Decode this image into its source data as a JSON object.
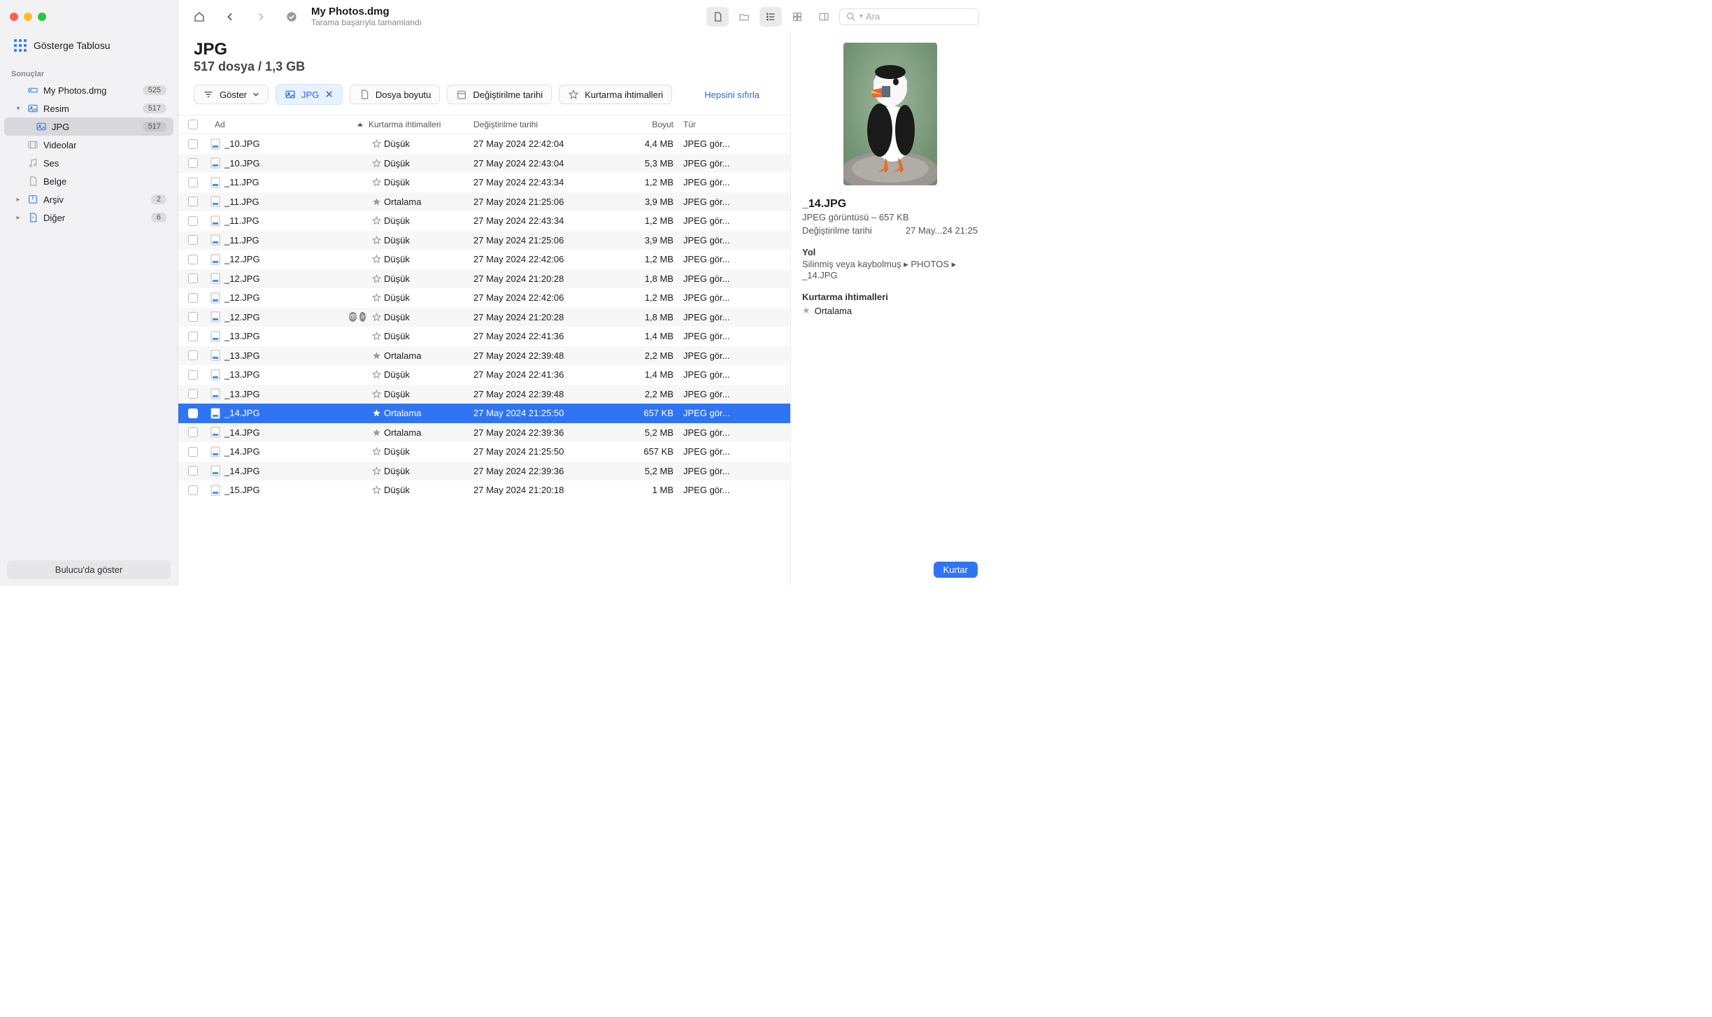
{
  "sidebar": {
    "dashboard": "Gösterge Tablosu",
    "sectionTitle": "Sonuçlar",
    "items": [
      {
        "label": "My Photos.dmg",
        "badge": "525",
        "icon": "drive",
        "chev": ""
      },
      {
        "label": "Resim",
        "badge": "517",
        "icon": "image",
        "chev": "▾"
      },
      {
        "label": "JPG",
        "badge": "517",
        "icon": "image",
        "sub": true,
        "active": true
      },
      {
        "label": "Videolar",
        "icon": "video"
      },
      {
        "label": "Ses",
        "icon": "audio"
      },
      {
        "label": "Belge",
        "icon": "doc"
      },
      {
        "label": "Arşiv",
        "badge": "2",
        "icon": "archive",
        "chev": "▸"
      },
      {
        "label": "Diğer",
        "badge": "6",
        "icon": "other",
        "chev": "▸"
      }
    ],
    "footerBtn": "Bulucu'da göster"
  },
  "toolbar": {
    "title": "My Photos.dmg",
    "subtitle": "Tarama başarıyla tamamlandı",
    "searchPlaceholder": "Ara"
  },
  "header": {
    "title": "JPG",
    "subtitle": "517 dosya / 1,3 GB"
  },
  "filters": {
    "show": "Göster",
    "active": "JPG",
    "size": "Dosya boyutu",
    "date": "Değiştirilme tarihi",
    "prob": "Kurtarma ihtimalleri",
    "reset": "Hepsini sıfırla"
  },
  "columns": {
    "name": "Ad",
    "prob": "Kurtarma ihtimalleri",
    "date": "Değiştirilme tarihi",
    "size": "Boyut",
    "type": "Tür"
  },
  "rows": [
    {
      "name": "_10.JPG",
      "prob": "Düşük",
      "star": false,
      "date": "27 May 2024 22:42:04",
      "size": "4,4 MB",
      "type": "JPEG gör..."
    },
    {
      "name": "_10.JPG",
      "prob": "Düşük",
      "star": false,
      "date": "27 May 2024 22:43:04",
      "size": "5,3 MB",
      "type": "JPEG gör..."
    },
    {
      "name": "_11.JPG",
      "prob": "Düşük",
      "star": false,
      "date": "27 May 2024 22:43:34",
      "size": "1,2 MB",
      "type": "JPEG gör..."
    },
    {
      "name": "_11.JPG",
      "prob": "Ortalama",
      "star": true,
      "date": "27 May 2024 21:25:06",
      "size": "3,9 MB",
      "type": "JPEG gör..."
    },
    {
      "name": "_11.JPG",
      "prob": "Düşük",
      "star": false,
      "date": "27 May 2024 22:43:34",
      "size": "1,2 MB",
      "type": "JPEG gör..."
    },
    {
      "name": "_11.JPG",
      "prob": "Düşük",
      "star": false,
      "date": "27 May 2024 21:25:06",
      "size": "3,9 MB",
      "type": "JPEG gör..."
    },
    {
      "name": "_12.JPG",
      "prob": "Düşük",
      "star": false,
      "date": "27 May 2024 22:42:06",
      "size": "1,2 MB",
      "type": "JPEG gör..."
    },
    {
      "name": "_12.JPG",
      "prob": "Düşük",
      "star": false,
      "date": "27 May 2024 21:20:28",
      "size": "1,8 MB",
      "type": "JPEG gör..."
    },
    {
      "name": "_12.JPG",
      "prob": "Düşük",
      "star": false,
      "date": "27 May 2024 22:42:06",
      "size": "1,2 MB",
      "type": "JPEG gör..."
    },
    {
      "name": "_12.JPG",
      "prob": "Düşük",
      "star": false,
      "date": "27 May 2024 21:20:28",
      "size": "1,8 MB",
      "type": "JPEG gör...",
      "ind": true
    },
    {
      "name": "_13.JPG",
      "prob": "Düşük",
      "star": false,
      "date": "27 May 2024 22:41:36",
      "size": "1,4 MB",
      "type": "JPEG gör..."
    },
    {
      "name": "_13.JPG",
      "prob": "Ortalama",
      "star": true,
      "date": "27 May 2024 22:39:48",
      "size": "2,2 MB",
      "type": "JPEG gör..."
    },
    {
      "name": "_13.JPG",
      "prob": "Düşük",
      "star": false,
      "date": "27 May 2024 22:41:36",
      "size": "1,4 MB",
      "type": "JPEG gör..."
    },
    {
      "name": "_13.JPG",
      "prob": "Düşük",
      "star": false,
      "date": "27 May 2024 22:39:48",
      "size": "2,2 MB",
      "type": "JPEG gör..."
    },
    {
      "name": "_14.JPG",
      "prob": "Ortalama",
      "star": true,
      "date": "27 May 2024 21:25:50",
      "size": "657 KB",
      "type": "JPEG gör...",
      "sel": true
    },
    {
      "name": "_14.JPG",
      "prob": "Ortalama",
      "star": true,
      "date": "27 May 2024 22:39:36",
      "size": "5,2 MB",
      "type": "JPEG gör..."
    },
    {
      "name": "_14.JPG",
      "prob": "Düşük",
      "star": false,
      "date": "27 May 2024 21:25:50",
      "size": "657 KB",
      "type": "JPEG gör..."
    },
    {
      "name": "_14.JPG",
      "prob": "Düşük",
      "star": false,
      "date": "27 May 2024 22:39:36",
      "size": "5,2 MB",
      "type": "JPEG gör..."
    },
    {
      "name": "_15.JPG",
      "prob": "Düşük",
      "star": false,
      "date": "27 May 2024 21:20:18",
      "size": "1 MB",
      "type": "JPEG gör..."
    }
  ],
  "preview": {
    "title": "_14.JPG",
    "typeLine": "JPEG görüntüsü – 657 KB",
    "dateLabel": "Değiştirilme tarihi",
    "dateValue": "27 May...24 21:25",
    "pathLabel": "Yol",
    "pathParts": [
      "Silinmiş veya kaybolmuş",
      "PHOTOS",
      "_14.JPG"
    ],
    "probLabel": "Kurtarma ihtimalleri",
    "probValue": "Ortalama",
    "recover": "Kurtar"
  }
}
